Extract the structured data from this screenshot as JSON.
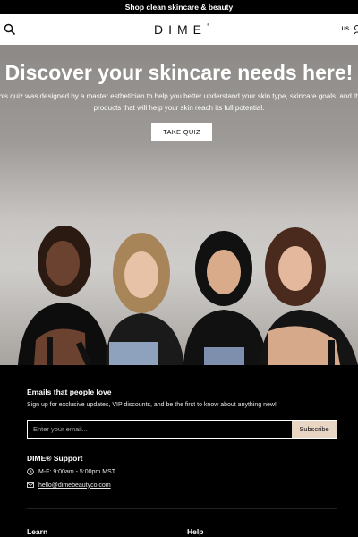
{
  "announcement": "Shop clean skincare & beauty",
  "header": {
    "logo": "DIME",
    "logo_mark": "®",
    "locale": "US"
  },
  "hero": {
    "headline": "Discover your skincare needs here!",
    "desc_line1": "This quiz was designed by a master esthetician to help you better understand your skin type, skincare goals, and the",
    "desc_line2": "products that will help your skin reach its full potential.",
    "cta": "TAKE QUIZ"
  },
  "footer": {
    "newsletter_title": "Emails that people love",
    "newsletter_text": "Sign up for exclusive updates, VIP discounts, and be the first to know about anything new!",
    "email_placeholder": "Enter your email...",
    "subscribe": "Subscribe",
    "support_title": "DIME® Support",
    "hours": "M-F: 9:00am - 5:00pm MST",
    "email": "hello@dimebeautyco.com",
    "col_learn": "Learn",
    "col_help": "Help"
  },
  "icons": {
    "search": "search-icon",
    "user": "user-icon",
    "clock": "clock-icon",
    "mail": "mail-icon"
  },
  "colors": {
    "accent": "#e9d5c4",
    "background": "#000000"
  }
}
